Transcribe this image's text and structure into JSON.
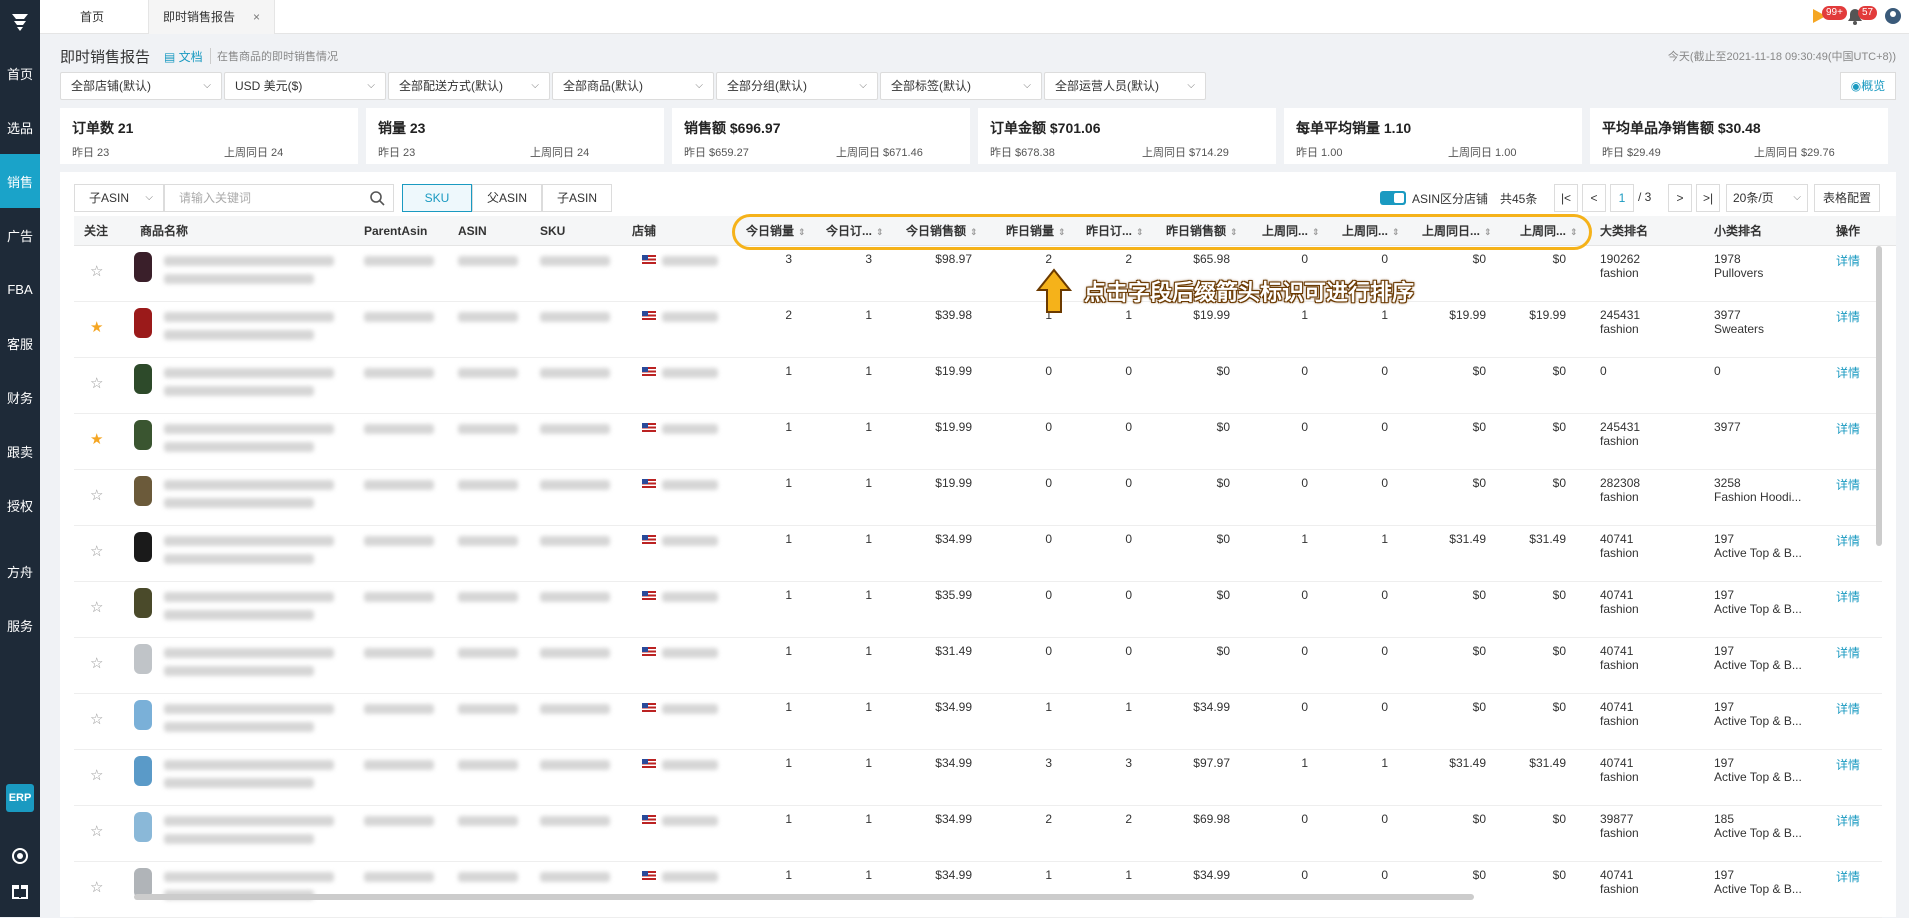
{
  "sidebar": {
    "items": [
      "首页",
      "选品",
      "销售",
      "广告",
      "FBA",
      "客服",
      "财务",
      "跟卖",
      "授权",
      "方舟",
      "服务"
    ],
    "erp": "ERP"
  },
  "tabs": [
    {
      "label": "首页"
    },
    {
      "label": "即时销售报告",
      "close": "×"
    }
  ],
  "badges": {
    "flag": "99+",
    "bell": "57"
  },
  "header": {
    "title": "即时销售报告",
    "doc": "文档",
    "desc": "在售商品的即时销售情况",
    "timestamp": "今天(截止至2021-11-18 09:30:49(中国UTC+8))"
  },
  "filters": [
    "全部店铺(默认)",
    "USD  美元($)",
    "全部配送方式(默认)",
    "全部商品(默认)",
    "全部分组(默认)",
    "全部标签(默认)",
    "全部运营人员(默认)"
  ],
  "overview": "概览",
  "stats": [
    {
      "title": "订单数 21",
      "a": "昨日 23",
      "b": "上周同日 24"
    },
    {
      "title": "销量 23",
      "a": "昨日 23",
      "b": "上周同日 24"
    },
    {
      "title": "销售额 $696.97",
      "a": "昨日 $659.27",
      "b": "上周同日 $671.46"
    },
    {
      "title": "订单金额 $701.06",
      "a": "昨日 $678.38",
      "b": "上周同日 $714.29"
    },
    {
      "title": "每单平均销量 1.10",
      "a": "昨日 1.00",
      "b": "上周同日 1.00"
    },
    {
      "title": "平均单品净销售额 $30.48",
      "a": "昨日 $29.49",
      "b": "上周同日 $29.76"
    }
  ],
  "toolbar": {
    "asin_select": "子ASIN",
    "search_placeholder": "请输入关键词",
    "seg": [
      "SKU",
      "父ASIN",
      "子ASIN"
    ],
    "toggle_label": "ASIN区分店铺",
    "total": "共45条",
    "page": "1",
    "pages": "/ 3",
    "page_size": "20条/页",
    "config": "表格配置"
  },
  "columns": [
    "关注",
    "商品名称",
    "ParentAsin",
    "ASIN",
    "SKU",
    "店铺",
    "今日销量",
    "今日订...",
    "今日销售额",
    "昨日销量",
    "昨日订...",
    "昨日销售额",
    "上周同...",
    "上周同...",
    "上周同日...",
    "上周同...",
    "大类排名",
    "小类排名",
    "操作"
  ],
  "callout": "点击字段后缀箭头标识可进行排序",
  "rows": [
    {
      "star": "☆",
      "thumb": "#3a1f2a",
      "v": [
        "3",
        "3",
        "$98.97",
        "2",
        "2",
        "$65.98",
        "0",
        "0",
        "$0",
        "$0"
      ],
      "r1": "190262",
      "r1b": "fashion",
      "r2": "1978",
      "r2b": "Pullovers"
    },
    {
      "star": "★",
      "thumb": "#9b1a1a",
      "v": [
        "2",
        "1",
        "$39.98",
        "1",
        "1",
        "$19.99",
        "1",
        "1",
        "$19.99",
        "$19.99"
      ],
      "r1": "245431",
      "r1b": "fashion",
      "r2": "3977",
      "r2b": "Sweaters"
    },
    {
      "star": "☆",
      "thumb": "#2d4a2a",
      "v": [
        "1",
        "1",
        "$19.99",
        "0",
        "0",
        "$0",
        "0",
        "0",
        "$0",
        "$0"
      ],
      "r1": "0",
      "r1b": "",
      "r2": "0",
      "r2b": ""
    },
    {
      "star": "★",
      "thumb": "#3a5530",
      "v": [
        "1",
        "1",
        "$19.99",
        "0",
        "0",
        "$0",
        "0",
        "0",
        "$0",
        "$0"
      ],
      "r1": "245431",
      "r1b": "fashion",
      "r2": "3977",
      "r2b": ""
    },
    {
      "star": "☆",
      "thumb": "#6b5a3a",
      "v": [
        "1",
        "1",
        "$19.99",
        "0",
        "0",
        "$0",
        "0",
        "0",
        "$0",
        "$0"
      ],
      "r1": "282308",
      "r1b": "fashion",
      "r2": "3258",
      "r2b": "Fashion Hoodi..."
    },
    {
      "star": "☆",
      "thumb": "#1a1a1a",
      "v": [
        "1",
        "1",
        "$34.99",
        "0",
        "0",
        "$0",
        "1",
        "1",
        "$31.49",
        "$31.49"
      ],
      "r1": "40741",
      "r1b": "fashion",
      "r2": "197",
      "r2b": "Active Top & B..."
    },
    {
      "star": "☆",
      "thumb": "#4a4a2a",
      "v": [
        "1",
        "1",
        "$35.99",
        "0",
        "0",
        "$0",
        "0",
        "0",
        "$0",
        "$0"
      ],
      "r1": "40741",
      "r1b": "fashion",
      "r2": "197",
      "r2b": "Active Top & B..."
    },
    {
      "star": "☆",
      "thumb": "#c0c4c8",
      "v": [
        "1",
        "1",
        "$31.49",
        "0",
        "0",
        "$0",
        "0",
        "0",
        "$0",
        "$0"
      ],
      "r1": "40741",
      "r1b": "fashion",
      "r2": "197",
      "r2b": "Active Top & B..."
    },
    {
      "star": "☆",
      "thumb": "#7ab0d8",
      "v": [
        "1",
        "1",
        "$34.99",
        "1",
        "1",
        "$34.99",
        "0",
        "0",
        "$0",
        "$0"
      ],
      "r1": "40741",
      "r1b": "fashion",
      "r2": "197",
      "r2b": "Active Top & B..."
    },
    {
      "star": "☆",
      "thumb": "#5a9ac8",
      "v": [
        "1",
        "1",
        "$34.99",
        "3",
        "3",
        "$97.97",
        "1",
        "1",
        "$31.49",
        "$31.49"
      ],
      "r1": "40741",
      "r1b": "fashion",
      "r2": "197",
      "r2b": "Active Top & B..."
    },
    {
      "star": "☆",
      "thumb": "#8ab8d8",
      "v": [
        "1",
        "1",
        "$34.99",
        "2",
        "2",
        "$69.98",
        "0",
        "0",
        "$0",
        "$0"
      ],
      "r1": "39877",
      "r1b": "fashion",
      "r2": "185",
      "r2b": "Active Top & B..."
    },
    {
      "star": "☆",
      "thumb": "#b0b4b8",
      "v": [
        "1",
        "1",
        "$34.99",
        "1",
        "1",
        "$34.99",
        "0",
        "0",
        "$0",
        "$0"
      ],
      "r1": "40741",
      "r1b": "fashion",
      "r2": "197",
      "r2b": "Active Top & B..."
    }
  ],
  "detail_label": "详情"
}
